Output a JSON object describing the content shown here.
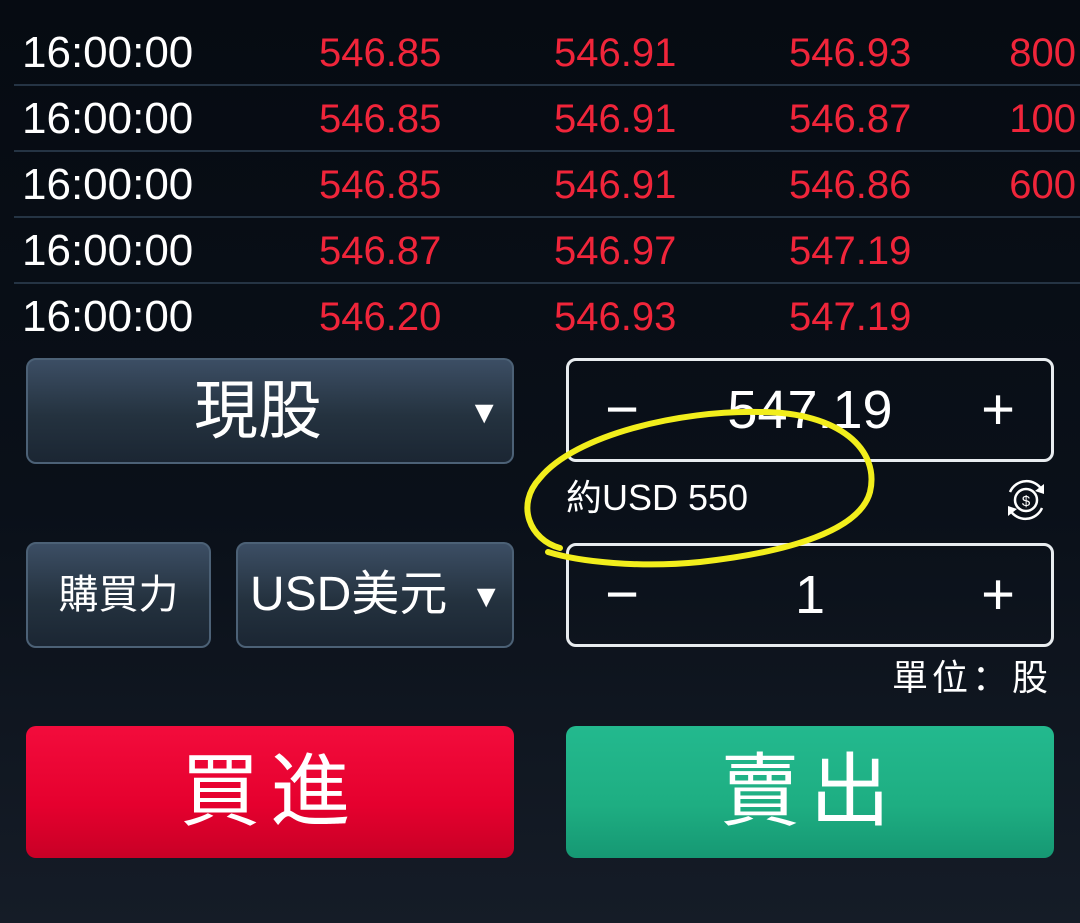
{
  "trades": [
    {
      "time": "16:00:00",
      "p1": "546.85",
      "p2": "546.91",
      "p3": "546.93",
      "volume": "800"
    },
    {
      "time": "16:00:00",
      "p1": "546.85",
      "p2": "546.91",
      "p3": "546.87",
      "volume": "100"
    },
    {
      "time": "16:00:00",
      "p1": "546.85",
      "p2": "546.91",
      "p3": "546.86",
      "volume": "600"
    },
    {
      "time": "16:00:00",
      "p1": "546.87",
      "p2": "546.97",
      "p3": "547.19",
      "volume": ""
    },
    {
      "time": "16:00:00",
      "p1": "546.20",
      "p2": "546.93",
      "p3": "547.19",
      "volume": ""
    }
  ],
  "order": {
    "stock_type": "現股",
    "buying_power_label": "購買力",
    "currency": "USD美元",
    "dropdown_arrow": "▼",
    "price": "547.19",
    "approx_amount": "約USD 550",
    "quantity": "1",
    "unit_label": "單位：股",
    "minus_symbol": "−",
    "plus_symbol": "+",
    "buy_label": "買進",
    "sell_label": "賣出"
  },
  "colors": {
    "price_red": "#f0253a",
    "buy_red": "#e5002e",
    "sell_green": "#1eae82",
    "annotation_yellow": "#f2ee1c"
  },
  "icons": {
    "convert": "currency-convert-icon"
  }
}
